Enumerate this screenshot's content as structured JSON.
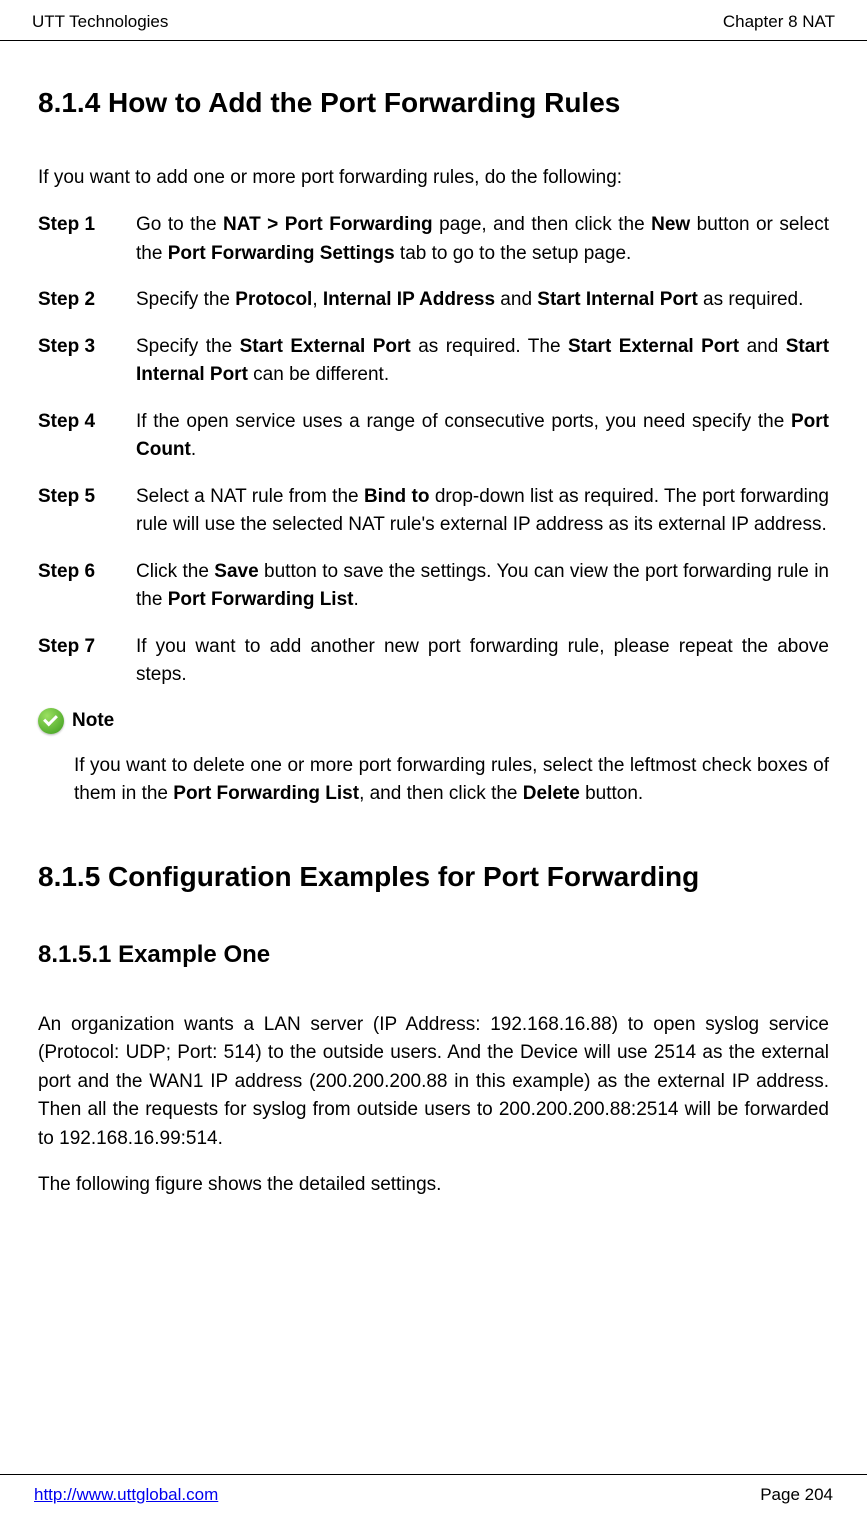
{
  "header": {
    "left": "UTT Technologies",
    "right": "Chapter 8 NAT"
  },
  "section1": {
    "heading": "8.1.4    How to Add the Port Forwarding Rules",
    "intro": "If you want to add one or more port forwarding rules, do the following:",
    "steps": [
      {
        "label": "Step 1",
        "pre": "Go to the ",
        "b1": "NAT > Port Forwarding",
        "mid1": " page, and then click the ",
        "b2": "New",
        "mid2": " button or select the ",
        "b3": "Port Forwarding Settings",
        "post": " tab to go to the setup page."
      },
      {
        "label": "Step 2",
        "pre": "Specify the ",
        "b1": "Protocol",
        "mid1": ", ",
        "b2": "Internal IP Address",
        "mid2": " and ",
        "b3": "Start Internal Port",
        "post": " as required."
      },
      {
        "label": "Step 3",
        "pre": "Specify the ",
        "b1": "Start External Port",
        "mid1": " as required. The ",
        "b2": "Start External Port",
        "mid2": " and ",
        "b3": "Start Internal Port",
        "post": " can be different."
      },
      {
        "label": "Step 4",
        "pre": "If the open service uses a range of consecutive ports, you need specify the ",
        "b1": "Port Count",
        "post": "."
      },
      {
        "label": "Step 5",
        "pre": "Select a NAT rule from the ",
        "b1": "Bind to",
        "post": " drop-down list as required. The port forwarding rule will use the selected NAT rule's external IP address as its external IP address."
      },
      {
        "label": "Step 6",
        "pre": "Click the ",
        "b1": "Save",
        "mid1": " button to save the settings. You can view the port forwarding rule in the ",
        "b2": "Port Forwarding List",
        "post": "."
      },
      {
        "label": "Step 7",
        "pre": "If you want to add another new port forwarding rule, please repeat the above steps."
      }
    ],
    "note": {
      "label": "Note",
      "pre": "If you want to delete one or more port forwarding rules, select the leftmost check boxes of them in the ",
      "b1": "Port Forwarding List",
      "mid1": ", and then click the ",
      "b2": "Delete",
      "post": " button."
    }
  },
  "section2": {
    "heading": "8.1.5    Configuration Examples for Port Forwarding",
    "subheading": "8.1.5.1   Example One",
    "para1": "An organization wants a LAN server (IP Address: 192.168.16.88) to open syslog service (Protocol: UDP; Port: 514) to the outside users. And the Device will use 2514 as the external port and the WAN1 IP address (200.200.200.88 in this example) as the external IP address. Then all the requests for syslog from outside users to 200.200.200.88:2514 will be forwarded to 192.168.16.99:514.",
    "para2": "The following figure shows the detailed settings."
  },
  "footer": {
    "link": "http://www.uttglobal.com",
    "page": "Page  204"
  }
}
